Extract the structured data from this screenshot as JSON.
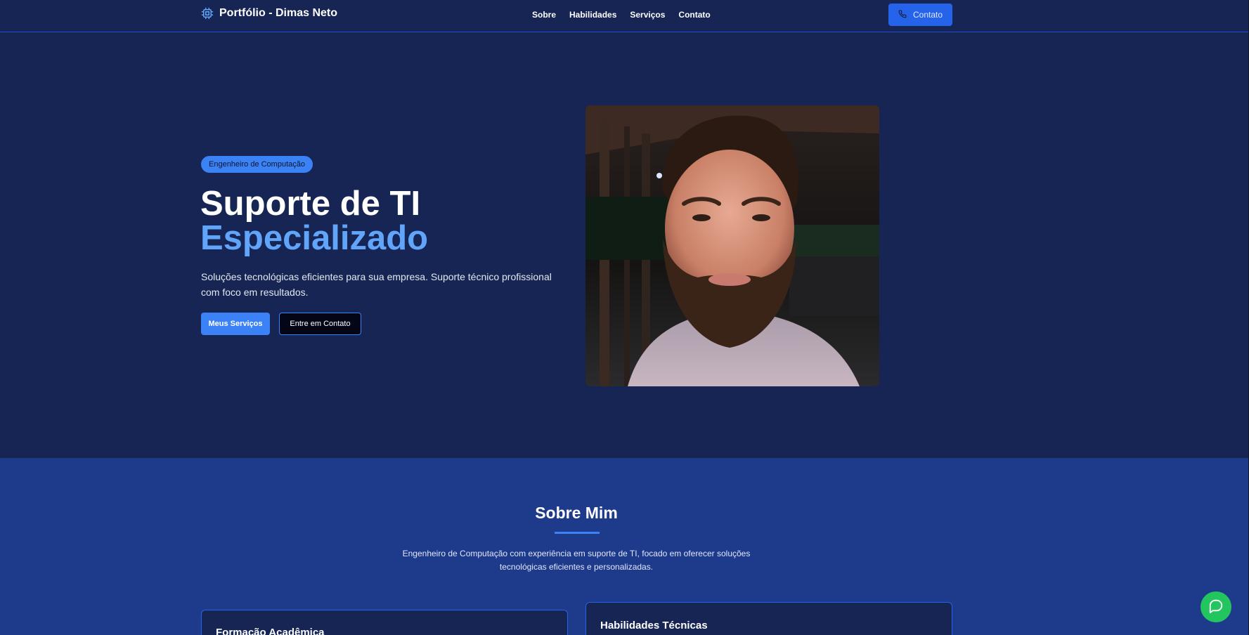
{
  "navbar": {
    "brand": "Portfólio - Dimas Neto",
    "links": [
      "Sobre",
      "Habilidades",
      "Serviços",
      "Contato"
    ],
    "contact_button": "Contato"
  },
  "hero": {
    "badge": "Engenheiro de Computação",
    "title": "Suporte de TI",
    "title_accent": "Especializado",
    "description": "Soluções tecnológicas eficientes para sua empresa. Suporte técnico profissional com foco em resultados.",
    "primary_button": "Meus Serviços",
    "secondary_button": "Entre em Contato"
  },
  "about": {
    "title": "Sobre Mim",
    "description": "Engenheiro de Computação com experiência em suporte de TI, focado em oferecer soluções tecnológicas eficientes e personalizadas.",
    "cards": [
      {
        "title": "Formação Acadêmica"
      },
      {
        "title": "Habilidades Técnicas"
      }
    ]
  },
  "colors": {
    "background": "#172554",
    "section_background": "#1e3a8a",
    "accent": "#3b82f6",
    "accent_text": "#60a5fa",
    "chat_button": "#22c55e"
  },
  "icons": {
    "brand": "chip-icon",
    "contact": "phone-icon",
    "chat": "chat-bubble-icon"
  }
}
